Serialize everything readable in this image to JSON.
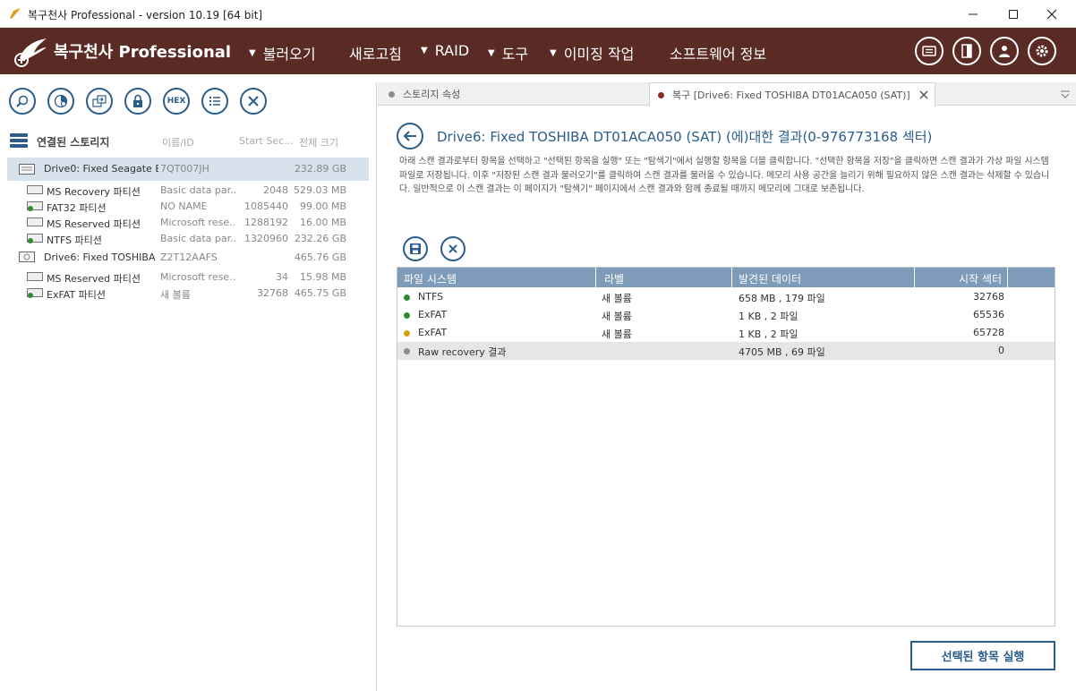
{
  "window": {
    "title": "복구천사 Professional - version 10.19 [64 bit]"
  },
  "brand": {
    "name": "복구천사 Professional"
  },
  "nav": {
    "items": [
      {
        "label": "불러오기",
        "has_dropdown": true
      },
      {
        "label": "새로고침",
        "has_dropdown": false
      },
      {
        "label": "RAID",
        "has_dropdown": true
      },
      {
        "label": "도구",
        "has_dropdown": true
      },
      {
        "label": "이미징 작업",
        "has_dropdown": true
      },
      {
        "label": "소프트웨어 정보",
        "has_dropdown": false
      }
    ],
    "right_icons": [
      "log-icon",
      "panel-icon",
      "user-icon",
      "gear-icon"
    ]
  },
  "left_toolbar": {
    "buttons": [
      "search-icon",
      "scan-icon",
      "copy-icon",
      "lock-icon",
      "hex-icon",
      "list-icon",
      "close-icon"
    ],
    "hex_label": "HEX"
  },
  "storage": {
    "header_title": "연결된 스토리지",
    "col_id": "이름/ID",
    "col_start": "Start Sec...",
    "col_size": "전체 크기",
    "rows": [
      {
        "name": "Drive0: Fixed Seagate B...",
        "id": "7QT007JH",
        "start": "",
        "size": "232.89 GB",
        "level": 0,
        "selected": true
      },
      {
        "name": "MS Recovery 파티션",
        "id": "Basic data par...",
        "start": "2048",
        "size": "529.03 MB",
        "level": 1
      },
      {
        "name": "FAT32 파티션",
        "id": "NO NAME",
        "start": "1085440",
        "size": "99.00 MB",
        "level": 1
      },
      {
        "name": "MS Reserved 파티션",
        "id": "Microsoft rese...",
        "start": "1288192",
        "size": "16.00 MB",
        "level": 1
      },
      {
        "name": "NTFS 파티션",
        "id": "Basic data par...",
        "start": "1320960",
        "size": "232.26 GB",
        "level": 1
      },
      {
        "name": "Drive6: Fixed TOSHIBA ...",
        "id": "Z2T12AAFS",
        "start": "",
        "size": "465.76 GB",
        "level": 0
      },
      {
        "name": "MS Reserved 파티션",
        "id": "Microsoft rese...",
        "start": "34",
        "size": "15.98 MB",
        "level": 1
      },
      {
        "name": "ExFAT 파티션",
        "id": "새 볼륨",
        "start": "32768",
        "size": "465.75 GB",
        "level": 1
      }
    ]
  },
  "tabs": [
    {
      "label": "스토리지 속성",
      "dot_color": "#8c8c8c",
      "active": false
    },
    {
      "label": "복구 [Drive6: Fixed TOSHIBA DT01ACA050 (SAT)]",
      "dot_color": "#8b2a2a",
      "active": true
    }
  ],
  "result": {
    "title": "Drive6: Fixed TOSHIBA DT01ACA050 (SAT) (에)대한 결과(0-976773168 섹터)",
    "description": "아래 스캔 결과로부터 항목을 선택하고 \"선택된 항목을 실행\" 또는 \"탐색기\"에서 실행할 항목을 더블 클릭합니다. \"선택한 항목을 저장\"을 클릭하면 스캔 결과가 가상 파일 시스템 파일로 저장됩니다. 이후 \"저장된 스캔 결과 불러오기\"를 클릭하여 스캔 결과를 불러올 수 있습니다. 메모리 사용 공간을 늘리기 위해 필요하지 않은 스캔 결과는 삭제할 수 있습니다. 일반적으로 이 스캔 결과는 이 페이지가 \"탐색기\" 페이지에서 스캔 결과와 함께 종료될 때까지 메모리에 그대로 보존됩니다.",
    "columns": [
      "파일 시스템",
      "라벨",
      "발견된 데이터",
      "시작 섹터"
    ],
    "rows": [
      {
        "fs": "NTFS",
        "label": "새 볼륨",
        "found": "658 MB , 179 파일",
        "start": "32768",
        "status_color": "#2e8b2e"
      },
      {
        "fs": "ExFAT",
        "label": "새 볼륨",
        "found": "1 KB , 2 파일",
        "start": "65536",
        "status_color": "#2e8b2e"
      },
      {
        "fs": "ExFAT",
        "label": "새 볼륨",
        "found": "1 KB , 2 파일",
        "start": "65728",
        "status_color": "#d4a017"
      },
      {
        "fs": "Raw recovery 결과",
        "label": "",
        "found": "4705 MB , 69 파일",
        "start": "0",
        "status_color": "#8c8c8c"
      }
    ],
    "run_button": "선택된 항목 실행"
  },
  "colors": {
    "nav_bg": "#5a2b24",
    "accent": "#2a5d8b",
    "table_header": "#7e9cb9",
    "selected_row": "#d7e2ed"
  }
}
